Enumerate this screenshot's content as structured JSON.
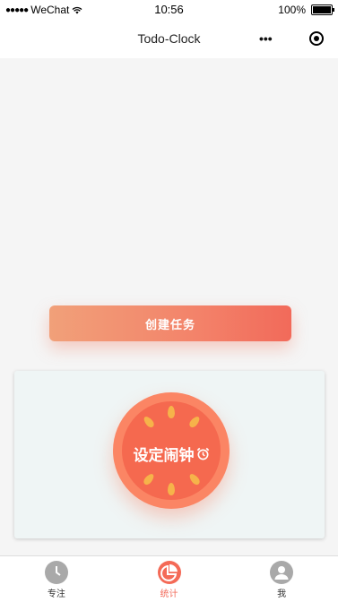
{
  "status_bar": {
    "carrier": "WeChat",
    "time": "10:56",
    "battery": "100%",
    "battery_level": 1.0
  },
  "nav": {
    "title": "Todo-Clock"
  },
  "main": {
    "create_task_label": "创建任务",
    "set_alarm_label": "设定闹钟"
  },
  "tabbar": {
    "items": [
      {
        "label": "专注",
        "icon": "clock-icon",
        "active": false
      },
      {
        "label": "统计",
        "icon": "pie-chart-icon",
        "active": true
      },
      {
        "label": "我",
        "icon": "user-icon",
        "active": false
      }
    ]
  },
  "colors": {
    "accent": "#f26a5a",
    "tomato": "#f5694f",
    "seed": "#f6b34a"
  }
}
